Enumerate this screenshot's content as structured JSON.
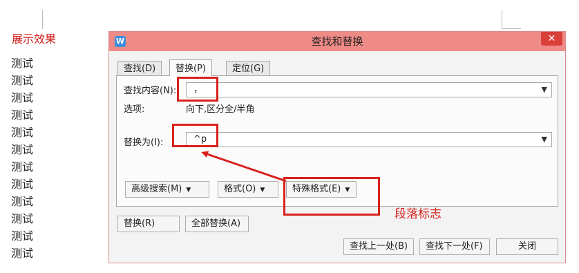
{
  "document": {
    "heading": "展示效果",
    "lines": [
      "测试",
      "测试",
      "测试",
      "测试",
      "测试",
      "测试",
      "测试",
      "测试",
      "测试",
      "测试",
      "测试",
      "测试"
    ]
  },
  "dialog": {
    "app_icon_text": "W",
    "title": "查找和替换",
    "close_label": "✕",
    "tabs": [
      {
        "label": "查找(D)",
        "active": false
      },
      {
        "label": "替换(P)",
        "active": true
      },
      {
        "label": "定位(G)",
        "active": false
      }
    ],
    "find": {
      "label": "查找内容(N):",
      "value": "，"
    },
    "options": {
      "label": "选项:",
      "value": "向下,区分全/半角"
    },
    "replace": {
      "label": "替换为(I):",
      "value": "^p"
    },
    "format_buttons": {
      "advanced": "高级搜索(M)",
      "format": "格式(O)",
      "special": "特殊格式(E)"
    },
    "buttons": {
      "replace": "替换(R)",
      "replace_all": "全部替换(A)",
      "find_prev": "查找上一处(B)",
      "find_next": "查找下一处(F)",
      "close": "关闭"
    }
  },
  "annotation": {
    "label": "段落标志",
    "color": "#d8211c"
  },
  "colors": {
    "titlebar": "#ef8b86",
    "close_button": "#d9403a",
    "accent_text": "#d0201c"
  }
}
